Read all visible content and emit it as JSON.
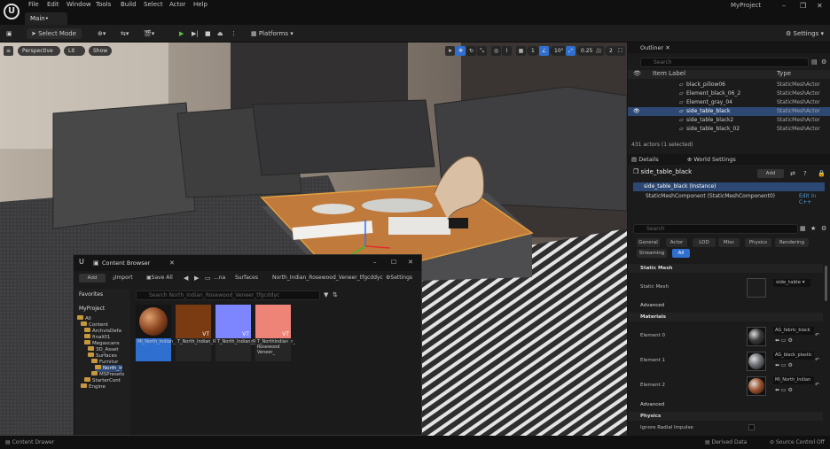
{
  "menubar": {
    "logo": "U",
    "items": [
      "File",
      "Edit",
      "Window",
      "Tools",
      "Build",
      "Select",
      "Actor",
      "Help"
    ],
    "project": "MyProject",
    "tab": "Main•"
  },
  "toolbar": {
    "mode": "Select Mode",
    "platforms": "Platforms",
    "settings": "Settings"
  },
  "viewport": {
    "perspective": "Perspective",
    "lit": "Lit",
    "show": "Show",
    "grid_num": "1",
    "angle": "10°",
    "scale": "0.25",
    "cam": "2"
  },
  "outliner": {
    "title": "Outliner",
    "search_placeholder": "Search",
    "col_label": "Item Label",
    "col_type": "Type",
    "rows": [
      {
        "name": "black_pillow06",
        "type": "StaticMeshActor",
        "sel": false
      },
      {
        "name": "Element_black_06_2",
        "type": "StaticMeshActor",
        "sel": false
      },
      {
        "name": "Element_gray_04",
        "type": "StaticMeshActor",
        "sel": false
      },
      {
        "name": "side_table_black",
        "type": "StaticMeshActor",
        "sel": true
      },
      {
        "name": "side_table_black2",
        "type": "StaticMeshActor",
        "sel": false
      },
      {
        "name": "side_table_black_02",
        "type": "StaticMeshActor",
        "sel": false
      }
    ],
    "count": "431 actors (1 selected)"
  },
  "details": {
    "tab": "Details",
    "tab2": "World Settings",
    "actor": "side_table_black",
    "add": "Add",
    "instance": "side_table_black (Instance)",
    "component": "StaticMeshComponent (StaticMeshComponent0)",
    "edit_cpp": "Edit in C++",
    "search_placeholder": "Search",
    "filters": [
      "General",
      "Actor",
      "LOD",
      "Misc",
      "Physics",
      "Rendering",
      "Streaming",
      "All"
    ],
    "sec_static": "Static Mesh",
    "lbl_static": "Static Mesh",
    "mesh_value": "side_table",
    "sec_adv": "Advanced",
    "sec_mat": "Materials",
    "elements": [
      {
        "label": "Element 0",
        "value": "AG_fabric_black",
        "color": "#3a3a3a"
      },
      {
        "label": "Element 1",
        "value": "AG_black_plastic",
        "color": "#6a6e72"
      },
      {
        "label": "Element 2",
        "value": "MI_North_Indian",
        "color": "#a0522d"
      }
    ],
    "sec_adv2": "Advanced",
    "sec_phys": "Physics",
    "lbl_phys": "Ignore Radial Impulse"
  },
  "content_browser": {
    "title": "Content Browser",
    "add": "Add",
    "import": "Import",
    "save_all": "Save All",
    "breadcrumb": [
      "...na",
      "Surfaces",
      "North_Indian_Rosewood_Veneer_tfgcddyc"
    ],
    "settings": "Settings",
    "favorites": "Favorites",
    "project": "MyProject",
    "search_placeholder": "Search North_Indian_Rosewood_Veneer_tfgcddyc",
    "tree": [
      "All",
      "Content",
      "ArchvisDefa",
      "finali01",
      "Megascans",
      "3D_Asset",
      "Surfaces",
      "Furnitur",
      "North_Ir",
      "MSPresets",
      "StarterCont",
      "Engine"
    ],
    "assets": [
      {
        "name": "MI_North_Indian_Rosewood_",
        "color": "#8a4520"
      },
      {
        "name": "T_North_Indian_Rosewood_Veneer_",
        "color": "#7a3b12"
      },
      {
        "name": "T_North_Indian_Rosewood_Veneer_",
        "color": "#7d86ff"
      },
      {
        "name": "T_NorthIndian Rosewood Veneer_",
        "color": "#ee8478"
      }
    ],
    "vt": "VT"
  },
  "status": {
    "drawer": "Content Drawer",
    "derived": "Derived Data",
    "source": "Source Control Off"
  }
}
